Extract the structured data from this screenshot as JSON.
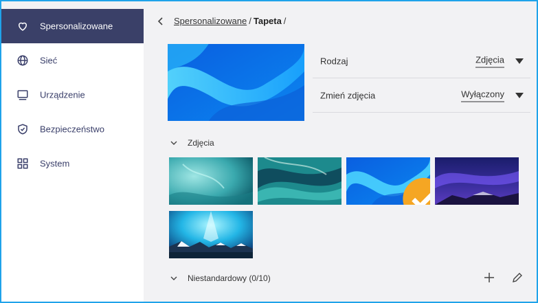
{
  "sidebar": {
    "items": [
      {
        "label": "Spersonalizowane",
        "icon": "heart-icon",
        "active": true
      },
      {
        "label": "Sieć",
        "icon": "globe-icon",
        "active": false
      },
      {
        "label": "Urządzenie",
        "icon": "monitor-icon",
        "active": false
      },
      {
        "label": "Bezpieczeństwo",
        "icon": "shield-check-icon",
        "active": false
      },
      {
        "label": "System",
        "icon": "grid-icon",
        "active": false
      }
    ]
  },
  "breadcrumb": {
    "parent": "Spersonalizowane",
    "current": "Tapeta",
    "separator": "/"
  },
  "settings": {
    "type_label": "Rodzaj",
    "type_value": "Zdjęcia",
    "change_label": "Zmień zdjęcia",
    "change_value": "Wyłączony"
  },
  "sections": {
    "photos_label": "Zdjęcia",
    "custom_label": "Niestandardowy (0/10)"
  },
  "thumbnails": [
    {
      "name": "ice-cave",
      "selected": false
    },
    {
      "name": "teal-marble",
      "selected": false
    },
    {
      "name": "blue-wave",
      "selected": true
    },
    {
      "name": "purple-aurora",
      "selected": false
    },
    {
      "name": "cyan-aurora-mountains",
      "selected": false
    }
  ],
  "colors": {
    "accent": "#1fa3ea",
    "sidebar_active": "#3a4068",
    "check": "#f5a623"
  }
}
